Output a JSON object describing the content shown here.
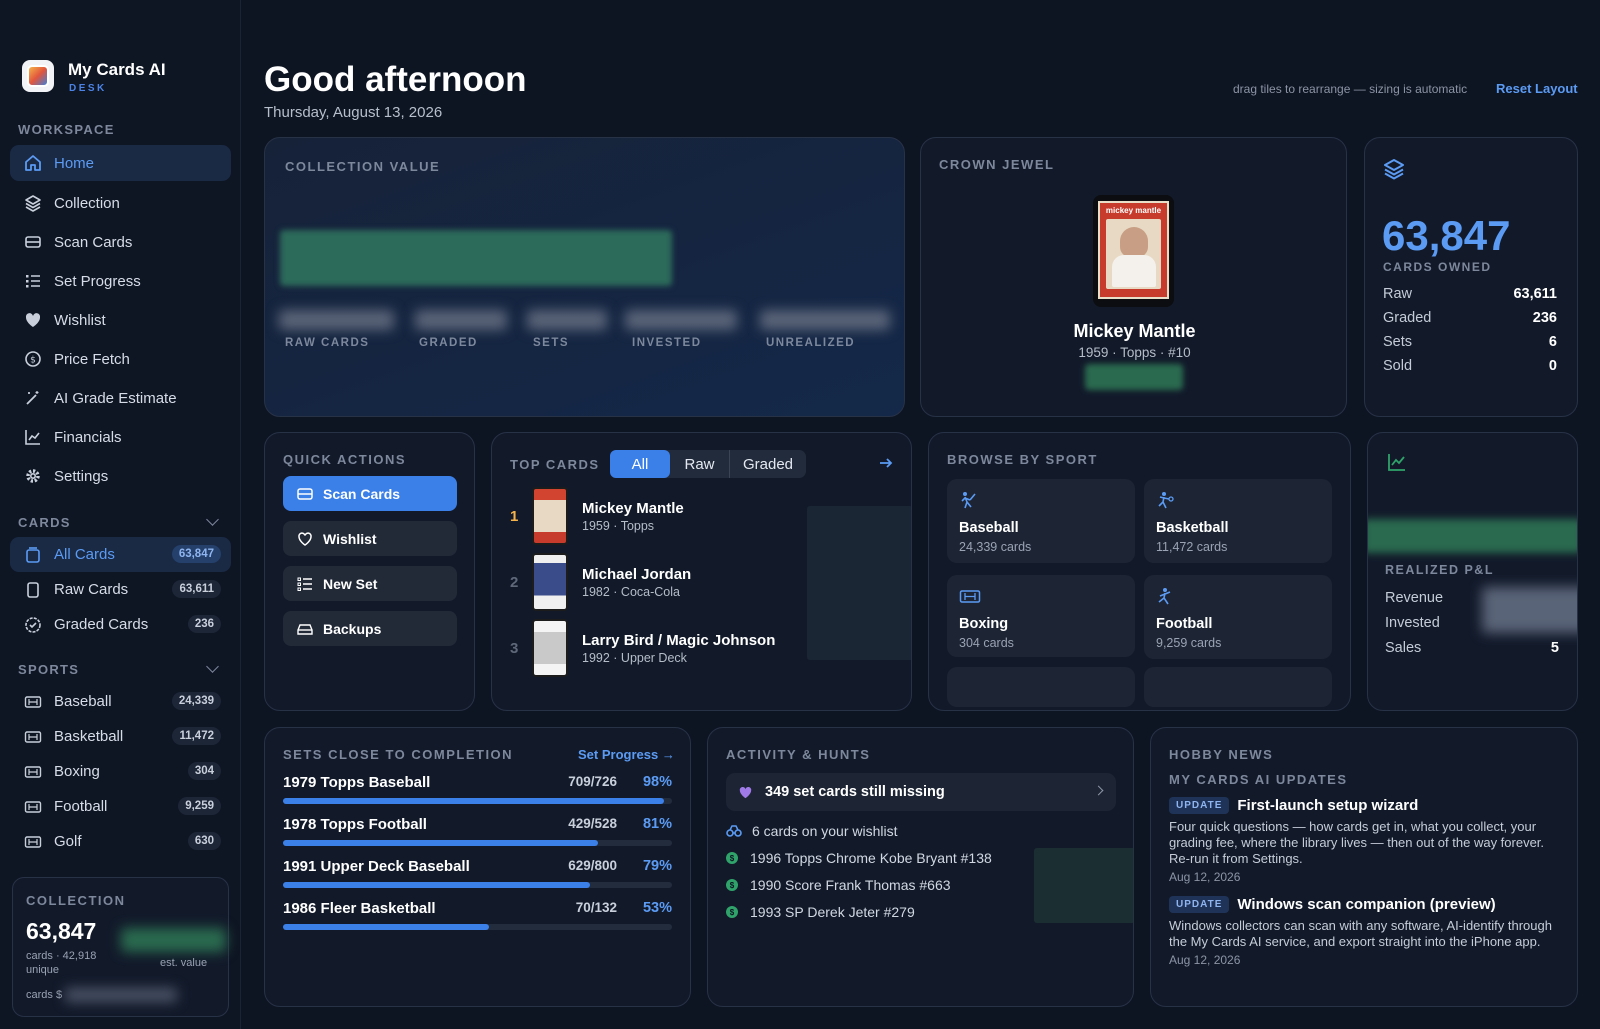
{
  "app": {
    "name": "My Cards AI",
    "subtitle": "DESK"
  },
  "sidebar": {
    "workspace_label": "WORKSPACE",
    "workspace_items": [
      {
        "label": "Home",
        "icon": "home-icon"
      },
      {
        "label": "Collection",
        "icon": "layers-icon"
      },
      {
        "label": "Scan Cards",
        "icon": "scanner-icon"
      },
      {
        "label": "Set Progress",
        "icon": "checklist-icon"
      },
      {
        "label": "Wishlist",
        "icon": "heart-icon"
      },
      {
        "label": "Price Fetch",
        "icon": "dollar-circle-icon"
      },
      {
        "label": "AI Grade Estimate",
        "icon": "magic-wand-icon"
      },
      {
        "label": "Financials",
        "icon": "line-chart-icon"
      },
      {
        "label": "Settings",
        "icon": "gear-icon"
      }
    ],
    "cards_label": "CARDS",
    "cards_items": [
      {
        "label": "All Cards",
        "count": "63,847"
      },
      {
        "label": "Raw Cards",
        "count": "63,611"
      },
      {
        "label": "Graded Cards",
        "count": "236"
      }
    ],
    "sports_label": "SPORTS",
    "sports_items": [
      {
        "label": "Baseball",
        "count": "24,339"
      },
      {
        "label": "Basketball",
        "count": "11,472"
      },
      {
        "label": "Boxing",
        "count": "304"
      },
      {
        "label": "Football",
        "count": "9,259"
      },
      {
        "label": "Golf",
        "count": "630"
      }
    ],
    "collection_box": {
      "label": "COLLECTION",
      "count": "63,847",
      "sub1": "cards · 42,918",
      "sub2": "unique",
      "est": "est. value",
      "foot": "cards $"
    }
  },
  "header": {
    "greeting": "Good afternoon",
    "date": "Thursday, August 13, 2026",
    "hint": "drag tiles to rearrange — sizing is automatic",
    "reset": "Reset Layout"
  },
  "collection_value": {
    "label": "COLLECTION VALUE",
    "stats": [
      "RAW CARDS",
      "GRADED",
      "SETS",
      "INVESTED",
      "UNREALIZED"
    ]
  },
  "crown_jewel": {
    "label": "CROWN JEWEL",
    "card_text": "mickey mantle",
    "name": "Mickey Mantle",
    "meta": "1959 · Topps · #10"
  },
  "cards_owned": {
    "count": "63,847",
    "label": "CARDS OWNED",
    "rows": [
      {
        "k": "Raw",
        "v": "63,611"
      },
      {
        "k": "Graded",
        "v": "236"
      },
      {
        "k": "Sets",
        "v": "6"
      },
      {
        "k": "Sold",
        "v": "0"
      }
    ]
  },
  "quick_actions": {
    "label": "QUICK ACTIONS",
    "items": [
      "Scan Cards",
      "Wishlist",
      "New Set",
      "Backups"
    ]
  },
  "top_cards": {
    "label": "TOP CARDS",
    "tabs": [
      "All",
      "Raw",
      "Graded"
    ],
    "items": [
      {
        "rank": "1",
        "name": "Mickey Mantle",
        "meta": "1959 · Topps"
      },
      {
        "rank": "2",
        "name": "Michael Jordan",
        "meta": "1982 · Coca-Cola"
      },
      {
        "rank": "3",
        "name": "Larry Bird / Magic Johnson",
        "meta": "1992 · Upper Deck"
      }
    ]
  },
  "browse_sport": {
    "label": "BROWSE BY SPORT",
    "items": [
      {
        "name": "Baseball",
        "count": "24,339 cards",
        "icon": "baseball-player-icon"
      },
      {
        "name": "Basketball",
        "count": "11,472 cards",
        "icon": "basketball-player-icon"
      },
      {
        "name": "Boxing",
        "count": "304 cards",
        "icon": "boxing-ring-icon"
      },
      {
        "name": "Football",
        "count": "9,259 cards",
        "icon": "football-player-icon"
      }
    ]
  },
  "realized": {
    "label": "REALIZED P&L",
    "rows": [
      {
        "k": "Revenue",
        "v": ""
      },
      {
        "k": "Invested",
        "v": ""
      },
      {
        "k": "Sales",
        "v": "5"
      }
    ]
  },
  "sets": {
    "label": "SETS CLOSE TO COMPLETION",
    "link": "Set Progress →",
    "items": [
      {
        "name": "1979 Topps Baseball",
        "count": "709/726",
        "pct": "98%",
        "fill": 0.98
      },
      {
        "name": "1978 Topps Football",
        "count": "429/528",
        "pct": "81%",
        "fill": 0.81
      },
      {
        "name": "1991 Upper Deck Baseball",
        "count": "629/800",
        "pct": "79%",
        "fill": 0.79
      },
      {
        "name": "1986 Fleer Basketball",
        "count": "70/132",
        "pct": "53%",
        "fill": 0.53
      }
    ]
  },
  "activity": {
    "label": "ACTIVITY & HUNTS",
    "missing": "349 set cards still missing",
    "wishlist": "6 cards on your wishlist",
    "items": [
      "1996 Topps Chrome Kobe Bryant #138",
      "1990 Score Frank Thomas #663",
      "1993 SP Derek Jeter #279"
    ]
  },
  "news": {
    "label": "HOBBY NEWS",
    "sub": "MY CARDS AI UPDATES",
    "items": [
      {
        "badge": "UPDATE",
        "title": "First-launch setup wizard",
        "body": "Four quick questions — how cards get in, what you collect, your grading fee, where the library lives — then out of the way forever. Re-run it from Settings.",
        "date": "Aug 12, 2026"
      },
      {
        "badge": "UPDATE",
        "title": "Windows scan companion (preview)",
        "body": "Windows collectors can scan with any software, AI-identify through the My Cards AI service, and export straight into the iPhone app.",
        "date": "Aug 12, 2026"
      }
    ]
  },
  "colors": {
    "accent": "#3b7fe8",
    "link": "#5b9bf4",
    "bg": "#0d1422",
    "card": "#121a2a",
    "green": "#2fa36a"
  }
}
